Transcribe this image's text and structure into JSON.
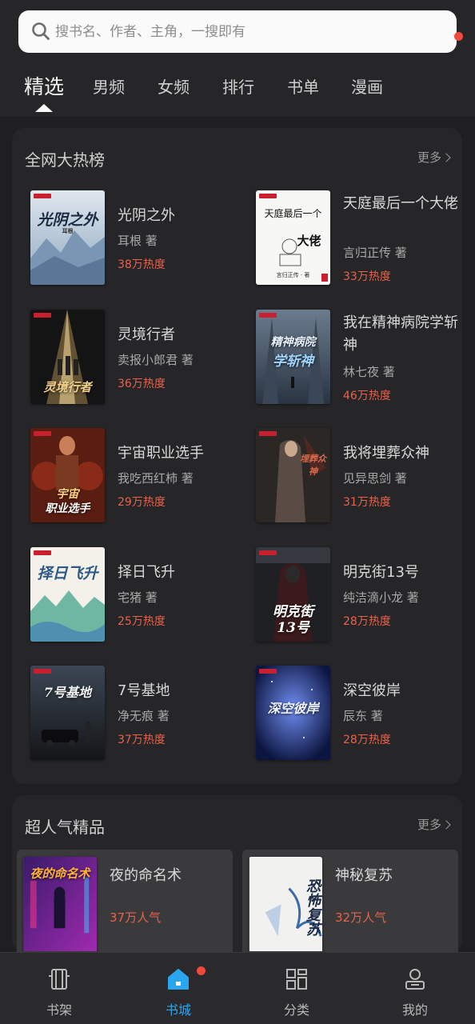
{
  "search": {
    "placeholder": "搜书名、作者、主角，一搜即有"
  },
  "tabs": [
    {
      "label": "精选",
      "active": true
    },
    {
      "label": "男频"
    },
    {
      "label": "女频"
    },
    {
      "label": "排行"
    },
    {
      "label": "书单"
    },
    {
      "label": "漫画"
    }
  ],
  "hot": {
    "title": "全网大热榜",
    "more": "更多",
    "books": [
      {
        "name": "光阴之外",
        "author": "耳根 著",
        "heat": "38万热度",
        "cover_text": "光阴之外",
        "cover_author": "耳根"
      },
      {
        "name": "天庭最后一个大佬",
        "author": "言归正传 著",
        "heat": "33万热度",
        "cover_text": "天庭最后一个",
        "cover_text2": "大佬",
        "cover_author": "言归正传 · 著"
      },
      {
        "name": "灵境行者",
        "author": "卖报小郎君 著",
        "heat": "36万热度",
        "cover_text": "灵境行者"
      },
      {
        "name": "我在精神病院学斩神",
        "author": "林七夜 著",
        "heat": "46万热度",
        "cover_text": "精神病院",
        "cover_text2": "学斩神"
      },
      {
        "name": "宇宙职业选手",
        "author": "我吃西红柿 著",
        "heat": "29万热度",
        "cover_text": "宇宙",
        "cover_text2": "职业选手"
      },
      {
        "name": "我将埋葬众神",
        "author": "见异思剑 著",
        "heat": "31万热度",
        "cover_text": "埋葬众神"
      },
      {
        "name": "择日飞升",
        "author": "宅猪 著",
        "heat": "25万热度",
        "cover_text": "择日飞升"
      },
      {
        "name": "明克街13号",
        "author": "纯洁滴小龙 著",
        "heat": "28万热度",
        "cover_text": "明克街",
        "cover_text2": "13号"
      },
      {
        "name": "7号基地",
        "author": "净无痕 著",
        "heat": "37万热度",
        "cover_text": "7号基地"
      },
      {
        "name": "深空彼岸",
        "author": "辰东 著",
        "heat": "28万热度",
        "cover_text": "深空彼岸"
      }
    ]
  },
  "popular": {
    "title": "超人气精品",
    "more": "更多",
    "books": [
      {
        "name": "夜的命名术",
        "pop": "37万人气",
        "cover_text": "夜的命名术"
      },
      {
        "name": "神秘复苏",
        "pop": "32万人气",
        "cover_text": "恐怖复苏"
      }
    ]
  },
  "nav": [
    {
      "label": "书架",
      "icon": "bookshelf-icon"
    },
    {
      "label": "书城",
      "icon": "bookstore-home-icon",
      "active": true,
      "badge": true
    },
    {
      "label": "分类",
      "icon": "category-grid-icon"
    },
    {
      "label": "我的",
      "icon": "profile-icon"
    }
  ],
  "colors": {
    "accent": "#2aa6f0",
    "heat": "#e8624a",
    "badge": "#f04a3a",
    "background": "#1f1f21"
  }
}
